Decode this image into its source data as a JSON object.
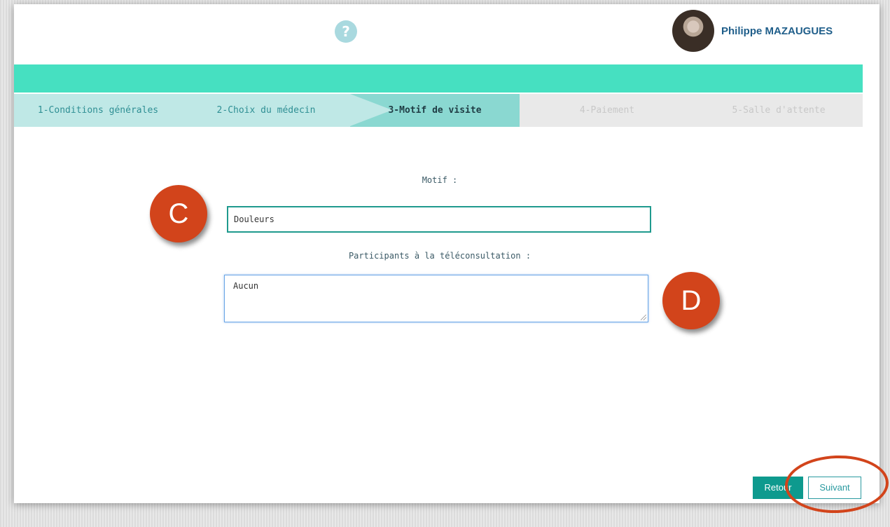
{
  "header": {
    "help_icon_glyph": "?",
    "help_icon_name": "help-icon",
    "user_name": "Philippe MAZAUGUES"
  },
  "steps": [
    {
      "label": "1-Conditions générales",
      "state": "done"
    },
    {
      "label": "2-Choix du médecin",
      "state": "done"
    },
    {
      "label": "3-Motif de visite",
      "state": "active"
    },
    {
      "label": "4-Paiement",
      "state": "todo"
    },
    {
      "label": "5-Salle d'attente",
      "state": "todo"
    }
  ],
  "form": {
    "motif_label": "Motif :",
    "motif_value": "Douleurs",
    "participants_label": "Participants à la téléconsultation :",
    "participants_value": "Aucun"
  },
  "annotations": {
    "badge_c": "C",
    "badge_d": "D"
  },
  "buttons": {
    "retour_label": "Retour",
    "suivant_label": "Suivant"
  },
  "colors": {
    "accent_teal": "#46e0c1",
    "primary_button": "#0e9a8e",
    "annotation_orange": "#d2441b",
    "user_name_blue": "#1f5e8a"
  }
}
